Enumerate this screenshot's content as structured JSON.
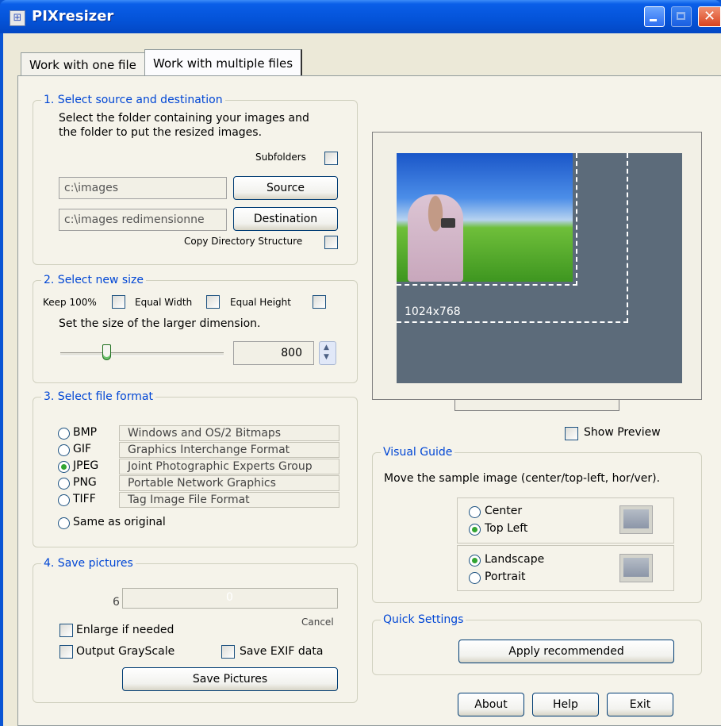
{
  "window": {
    "title": "PIXresizer"
  },
  "tabs": [
    {
      "label": "Work with one file"
    },
    {
      "label": "Work with multiple files"
    }
  ],
  "source_dest": {
    "title": "1. Select source and destination",
    "description_line1": "Select the folder containing your images and",
    "description_line2": "the folder to put the resized images.",
    "subfolders_label": "Subfolders",
    "source_path": "c:\\images",
    "source_button": "Source",
    "dest_path": "c:\\images redimensionne",
    "dest_button": "Destination",
    "copy_structure_label": "Copy Directory Structure"
  },
  "new_size": {
    "title": "2. Select new size",
    "keep_label": "Keep 100%",
    "equal_width_label": "Equal Width",
    "equal_height_label": "Equal Height",
    "instruction": "Set the size of the larger dimension.",
    "value": "800",
    "slider_fraction": 0.27
  },
  "file_format": {
    "title": "3. Select file format",
    "options": [
      {
        "name": "BMP",
        "desc": "Windows and OS/2 Bitmaps",
        "selected": false
      },
      {
        "name": "GIF",
        "desc": "Graphics Interchange Format",
        "selected": false
      },
      {
        "name": "JPEG",
        "desc": "Joint Photographic Experts Group",
        "selected": true
      },
      {
        "name": "PNG",
        "desc": "Portable Network Graphics",
        "selected": false
      },
      {
        "name": "TIFF",
        "desc": "Tag Image File Format",
        "selected": false
      }
    ],
    "same_as_original": "Same as original"
  },
  "save": {
    "title": "4. Save pictures",
    "count": "6",
    "progress_text": "0",
    "cancel_label": "Cancel",
    "enlarge_label": "Enlarge if needed",
    "grayscale_label": "Output GrayScale",
    "exif_label": "Save EXIF data",
    "save_button": "Save Pictures"
  },
  "preview": {
    "resolution_label": "1024x768",
    "show_preview_label": "Show Preview"
  },
  "visual_guide": {
    "title": "Visual Guide",
    "instruction": "Move the sample image (center/top-left, hor/ver).",
    "position_options": [
      {
        "label": "Center",
        "selected": false
      },
      {
        "label": "Top Left",
        "selected": true
      }
    ],
    "orientation_options": [
      {
        "label": "Landscape",
        "selected": true
      },
      {
        "label": "Portrait",
        "selected": false
      }
    ]
  },
  "quick_settings": {
    "title": "Quick Settings",
    "apply_button": "Apply recommended"
  },
  "footer": {
    "about_button": "About",
    "help_button": "Help",
    "exit_button": "Exit"
  },
  "colors": {
    "titlebar": "#0453d8",
    "group_label": "#0046d5",
    "preview_bg": "#5c6b7a",
    "radio_selected": "#32a532"
  }
}
